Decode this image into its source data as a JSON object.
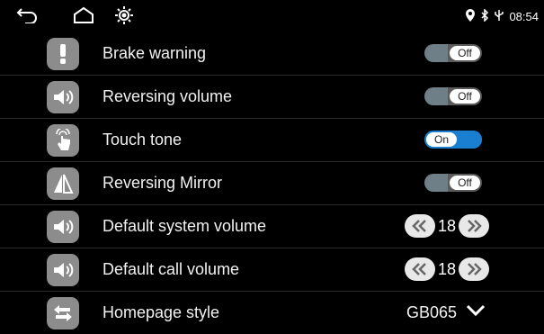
{
  "statusbar": {
    "time": "08:54"
  },
  "settings": {
    "brake_warning": {
      "label": "Brake warning",
      "state": "Off"
    },
    "reversing_volume": {
      "label": "Reversing volume",
      "state": "Off"
    },
    "touch_tone": {
      "label": "Touch tone",
      "state": "On"
    },
    "reversing_mirror": {
      "label": "Reversing Mirror",
      "state": "Off"
    },
    "default_system_volume": {
      "label": "Default system volume",
      "value": "18"
    },
    "default_call_volume": {
      "label": "Default call volume",
      "value": "18"
    },
    "homepage_style": {
      "label": "Homepage style",
      "value": "GB065"
    }
  },
  "colors": {
    "accent": "#1a7fd1",
    "icon_bg": "#8c8c8c",
    "toggle_off": "#5a5a5a"
  }
}
